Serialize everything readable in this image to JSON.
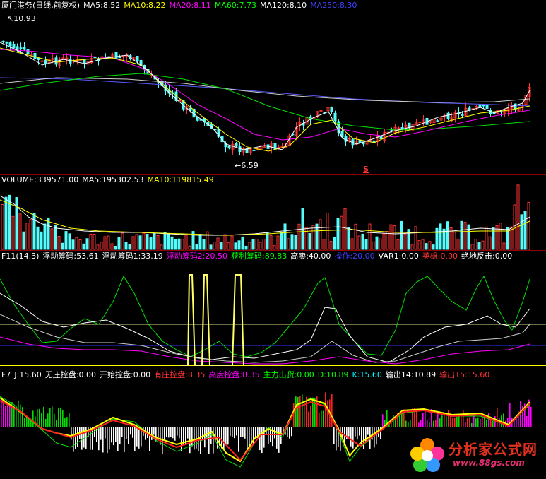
{
  "main_panel": {
    "header": {
      "title": "厦门港务(日线,前复权)",
      "ma5": "MA5:8.52",
      "ma10": "MA10:8.22",
      "ma20": "MA20:8.11",
      "ma60": "MA60:7.73",
      "ma120": "MA120:8.10",
      "ma250": "MA250:8.30"
    },
    "high_marker": "10.93",
    "low_marker": "6.59",
    "s_marker": "S"
  },
  "volume_panel": {
    "header": {
      "volume": "VOLUME:339571.00",
      "ma5": "MA5:195302.53",
      "ma10": "MA10:119815.49"
    }
  },
  "f11_panel": {
    "header": {
      "name": "F11(14,3)",
      "i1": "浮动筹码:53.61",
      "i2": "浮动筹码1:33.19",
      "i3": "浮动筹码2:20.50",
      "i4": "获利筹码:89.83",
      "i5": "高卖:40.00",
      "i6": "操作:20.00",
      "i7": "VAR1:0.00",
      "i8": "英雄:0.00",
      "i9": "绝地反击:0.00"
    }
  },
  "f7_panel": {
    "header": {
      "name": "F7",
      "j": "J:15.60",
      "i1": "无庄控盘:0.00",
      "i2": "开始控盘:0.00",
      "i3": "有庄控盘:8.35",
      "i4": "高度控盘:8.35",
      "i5": "主力出货:0.00",
      "d": "D:10.89",
      "k": "K:15.60",
      "o1": "输出14:10.89",
      "o2": "输出15:15.60"
    }
  },
  "watermark": {
    "title": "分析家公式网",
    "url": "www.88gs.com"
  },
  "colors": {
    "ma5": "#ffffff",
    "ma10": "#ffff00",
    "ma20": "#ff00ff",
    "ma60": "#00ff00",
    "ma120": "#ffffff",
    "ma250": "#4040ff",
    "up": "#ff3232",
    "down": "#54fcfc"
  }
}
